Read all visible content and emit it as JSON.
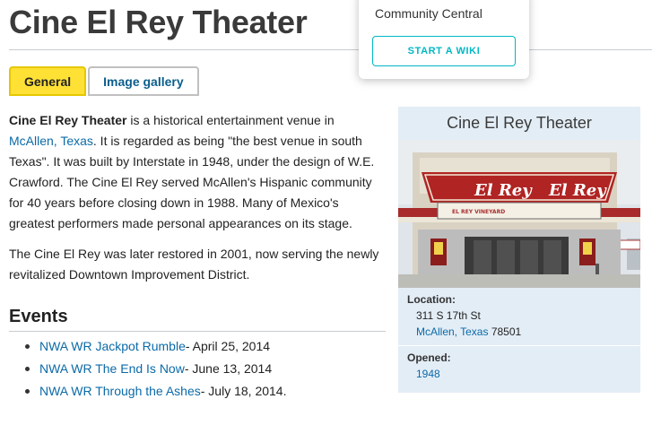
{
  "page": {
    "title": "Cine El Rey Theater"
  },
  "tabs": [
    {
      "label": "General",
      "active": true
    },
    {
      "label": "Image gallery",
      "active": false
    }
  ],
  "article": {
    "p1": {
      "bold": "Cine El Rey Theater",
      "t1": " is a historical entertainment venue in ",
      "link": "McAllen, Texas",
      "t2": ". It is regarded as being \"the best venue in south Texas\". It was built by Interstate in 1948, under the design of W.E. Crawford. The Cine El Rey served McAllen's Hispanic community for 40 years before closing down in 1988. Many of Mexico's greatest performers made personal appearances on its stage."
    },
    "p2": "The Cine El Rey was later restored in 2001, now serving the newly revitalized Downtown Improvement District."
  },
  "events": {
    "heading": "Events",
    "items": [
      {
        "link": "NWA WR Jackpot Rumble",
        "date": " - April 25, 2014"
      },
      {
        "link": "NWA WR The End Is Now",
        "date": " - June 13, 2014"
      },
      {
        "link": "NWA WR Through the Ashes",
        "date": " - July 18, 2014."
      }
    ]
  },
  "infobox": {
    "title": "Cine El Rey Theater",
    "image_marquee": "El Rey",
    "image_sub": "EL REY VINEYARD",
    "location_label": "Location:",
    "location_street": "311 S 17th St",
    "location_city": "McAllen, Texas",
    "location_zip": " 78501",
    "opened_label": "Opened:",
    "opened_value": "1948"
  },
  "popup": {
    "text": "Community Central",
    "button": "START A WIKI"
  },
  "colors": {
    "tab_active": "#ffe135",
    "link": "#0b6aa8",
    "infobox_bg": "#e3edf6",
    "accent": "#00b7c4"
  }
}
